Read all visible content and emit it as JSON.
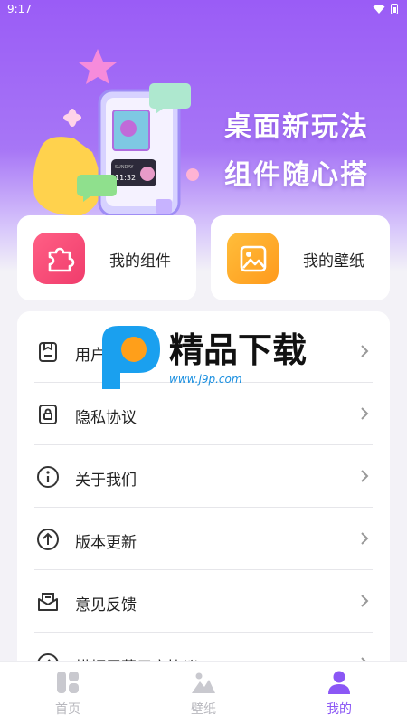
{
  "status_bar": {
    "time": "9:17",
    "wifi_icon": "wifi-icon",
    "battery_icon": "battery-icon"
  },
  "hero": {
    "slogan_line1": "桌面新玩法",
    "slogan_line2": "组件随心搭",
    "phone_time": "11:32",
    "phone_label": "SUNDAY"
  },
  "quick_actions": [
    {
      "label": "我的组件",
      "icon": "puzzle-icon",
      "color": "#f34a72"
    },
    {
      "label": "我的壁纸",
      "icon": "image-icon",
      "color": "#ffaa25"
    }
  ],
  "menu": {
    "items": [
      {
        "label": "用户协议",
        "icon": "document-icon"
      },
      {
        "label": "隐私协议",
        "icon": "lock-document-icon"
      },
      {
        "label": "关于我们",
        "icon": "info-icon"
      },
      {
        "label": "版本更新",
        "icon": "upload-arrow-icon"
      },
      {
        "label": "意见反馈",
        "icon": "mail-icon"
      },
      {
        "label": "横幅屏幕用户协议",
        "icon": "back-circle-icon"
      }
    ]
  },
  "watermark": {
    "brand": "精品下载",
    "url": "www.j9p.com"
  },
  "tabbar": {
    "tabs": [
      {
        "label": "首页",
        "icon": "home-grid-icon",
        "active": false
      },
      {
        "label": "壁纸",
        "icon": "wallpaper-icon",
        "active": false
      },
      {
        "label": "我的",
        "icon": "profile-icon",
        "active": true
      }
    ]
  },
  "colors": {
    "accent": "#8b57f5",
    "hero_top": "#9a5cf6",
    "background": "#f3f2f7"
  }
}
